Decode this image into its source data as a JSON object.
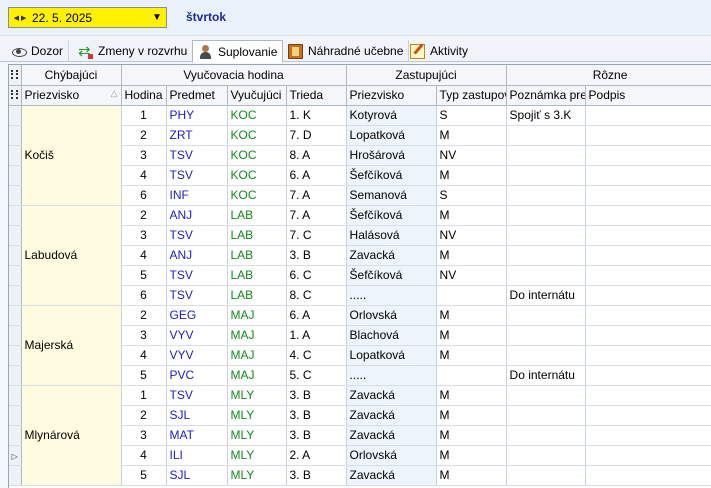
{
  "toolbar": {
    "date_value": "22. 5. 2025",
    "day_name": "štvrtok",
    "accent_color": "#fff200"
  },
  "tabs": [
    {
      "label": "Dozor",
      "icon": "eye-icon"
    },
    {
      "label": "Zmeny v rozvrhu",
      "icon": "swap-icon"
    },
    {
      "label": "Suplovanie",
      "icon": "person-icon"
    },
    {
      "label": "Náhradné učebne",
      "icon": "book-icon"
    },
    {
      "label": "Aktivity",
      "icon": "note-icon"
    }
  ],
  "grid": {
    "groups": [
      "Chýbajúci",
      "Vyučovacia hodina",
      "Zastupujúci",
      "Rôzne"
    ],
    "columns": [
      "Priezvisko",
      "Hodina",
      "Predmet",
      "Vyučujúci",
      "Trieda",
      "Priezvisko",
      "Typ zastupov",
      "Poznámka pre",
      "Podpis"
    ],
    "rows": [
      {
        "absent": "Kočiš",
        "hodina": "1",
        "predmet": "PHY",
        "vyucujuci": "KOC",
        "trieda": "1. K",
        "zastupujuci": "Kotyrová",
        "typ": "S",
        "poznamka": "Spojiť s 3.K",
        "podpis": ""
      },
      {
        "absent": "",
        "hodina": "2",
        "predmet": "ZRT",
        "vyucujuci": "KOC",
        "trieda": "7. D",
        "zastupujuci": "Lopatková",
        "typ": "M",
        "poznamka": "",
        "podpis": ""
      },
      {
        "absent": "",
        "hodina": "3",
        "predmet": "TSV",
        "vyucujuci": "KOC",
        "trieda": "8. A",
        "zastupujuci": "Hrošárová",
        "typ": "NV",
        "poznamka": "",
        "podpis": ""
      },
      {
        "absent": "",
        "hodina": "4",
        "predmet": "TSV",
        "vyucujuci": "KOC",
        "trieda": "6. A",
        "zastupujuci": "Šefčíková",
        "typ": "M",
        "poznamka": "",
        "podpis": ""
      },
      {
        "absent": "",
        "hodina": "6",
        "predmet": "INF",
        "vyucujuci": "KOC",
        "trieda": "7. A",
        "zastupujuci": "Semanová",
        "typ": "S",
        "poznamka": "",
        "podpis": ""
      },
      {
        "absent": "Labudová",
        "hodina": "2",
        "predmet": "ANJ",
        "vyucujuci": "LAB",
        "trieda": "7. A",
        "zastupujuci": "Šefčíková",
        "typ": "M",
        "poznamka": "",
        "podpis": ""
      },
      {
        "absent": "",
        "hodina": "3",
        "predmet": "TSV",
        "vyucujuci": "LAB",
        "trieda": "7. C",
        "zastupujuci": "Halásová",
        "typ": "NV",
        "poznamka": "",
        "podpis": ""
      },
      {
        "absent": "",
        "hodina": "4",
        "predmet": "ANJ",
        "vyucujuci": "LAB",
        "trieda": "3. B",
        "zastupujuci": "Zavacká",
        "typ": "M",
        "poznamka": "",
        "podpis": ""
      },
      {
        "absent": "",
        "hodina": "5",
        "predmet": "TSV",
        "vyucujuci": "LAB",
        "trieda": "6. C",
        "zastupujuci": "Šefčíková",
        "typ": "NV",
        "poznamka": "",
        "podpis": ""
      },
      {
        "absent": "",
        "hodina": "6",
        "predmet": "TSV",
        "vyucujuci": "LAB",
        "trieda": "8. C",
        "zastupujuci": ".....",
        "typ": "",
        "poznamka": "Do internátu",
        "podpis": ""
      },
      {
        "absent": "Majerská",
        "hodina": "2",
        "predmet": "GEG",
        "vyucujuci": "MAJ",
        "trieda": "6. A",
        "zastupujuci": "Orlovská",
        "typ": "M",
        "poznamka": "",
        "podpis": ""
      },
      {
        "absent": "",
        "hodina": "3",
        "predmet": "VYV",
        "vyucujuci": "MAJ",
        "trieda": "1. A",
        "zastupujuci": "Blachová",
        "typ": "M",
        "poznamka": "",
        "podpis": ""
      },
      {
        "absent": "",
        "hodina": "4",
        "predmet": "VYV",
        "vyucujuci": "MAJ",
        "trieda": "4. C",
        "zastupujuci": "Lopatková",
        "typ": "M",
        "poznamka": "",
        "podpis": ""
      },
      {
        "absent": "",
        "hodina": "5",
        "predmet": "PVC",
        "vyucujuci": "MAJ",
        "trieda": "5. C",
        "zastupujuci": ".....",
        "typ": "",
        "poznamka": "Do internátu",
        "podpis": ""
      },
      {
        "absent": "Mlynárová",
        "hodina": "1",
        "predmet": "TSV",
        "vyucujuci": "MLY",
        "trieda": "3. B",
        "zastupujuci": "Zavacká",
        "typ": "M",
        "poznamka": "",
        "podpis": ""
      },
      {
        "absent": "",
        "hodina": "2",
        "predmet": "SJL",
        "vyucujuci": "MLY",
        "trieda": "3. B",
        "zastupujuci": "Zavacká",
        "typ": "M",
        "poznamka": "",
        "podpis": ""
      },
      {
        "absent": "",
        "hodina": "3",
        "predmet": "MAT",
        "vyucujuci": "MLY",
        "trieda": "3. B",
        "zastupujuci": "Zavacká",
        "typ": "M",
        "poznamka": "",
        "podpis": ""
      },
      {
        "absent": "",
        "hodina": "4",
        "predmet": "ILI",
        "vyucujuci": "MLY",
        "trieda": "2. A",
        "zastupujuci": "Orlovská",
        "typ": "M",
        "poznamka": "",
        "podpis": ""
      },
      {
        "absent": "",
        "hodina": "5",
        "predmet": "SJL",
        "vyucujuci": "MLY",
        "trieda": "3. B",
        "zastupujuci": "Zavacká",
        "typ": "M",
        "poznamka": "",
        "podpis": ""
      }
    ],
    "current_row": 17
  }
}
